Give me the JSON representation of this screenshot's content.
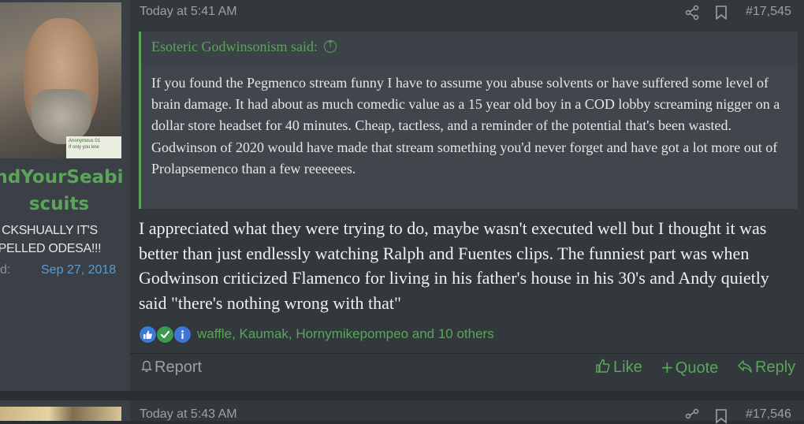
{
  "post": {
    "timestamp": "Today at 5:41 AM",
    "post_number": "#17,545",
    "user": {
      "username": "ndYourSeabiscuits",
      "username_lines": [
        "ndYourSeabi",
        "scuits"
      ],
      "title_lines": [
        "CKSHUALLY IT'S",
        "PELLED ODESA!!!"
      ],
      "joined_label": "d:",
      "joined_value": "Sep 27, 2018",
      "avatar_badge": [
        "Anonymous 01",
        "If only you kne"
      ]
    },
    "quote": {
      "header": "Esoteric Godwinsonism said:",
      "body": "If you found the Pegmenco stream funny I have to assume you abuse solvents or have suffered some level of brain damage. It had about as much comedic value as a 15 year old boy in a COD lobby screaming nigger on a dollar store headset for 40 minutes. Cheap, tactless, and a reminder of the potential that's been wasted. Godwinson of 2020 would have made that stream something you'd never forget and have got a lot more out of Prolapsemenco than a few reeeeees."
    },
    "message": "I appreciated what they were trying to do, maybe wasn't executed well but I thought it was better than just endlessly watching Ralph and Fuentes clips. The funniest part was when Godwinson criticized Flamenco for living in his father's house in his 30's and Andy quietly said \"there's nothing wrong with that\"",
    "reactions": {
      "icons": [
        "like-reaction-icon",
        "agree-reaction-icon",
        "informative-reaction-icon"
      ],
      "names": "waffle, Kaumak, Hornymikepompeo and 10 others"
    },
    "actions": {
      "report": "Report",
      "like": "Like",
      "quote": "Quote",
      "reply": "Reply"
    }
  },
  "next_post": {
    "timestamp": "Today at 5:43 AM",
    "post_number": "#17,546"
  },
  "colors": {
    "accent_green": "#5aa55a",
    "link_blue": "#5b9bd5",
    "background": "#33383d"
  }
}
